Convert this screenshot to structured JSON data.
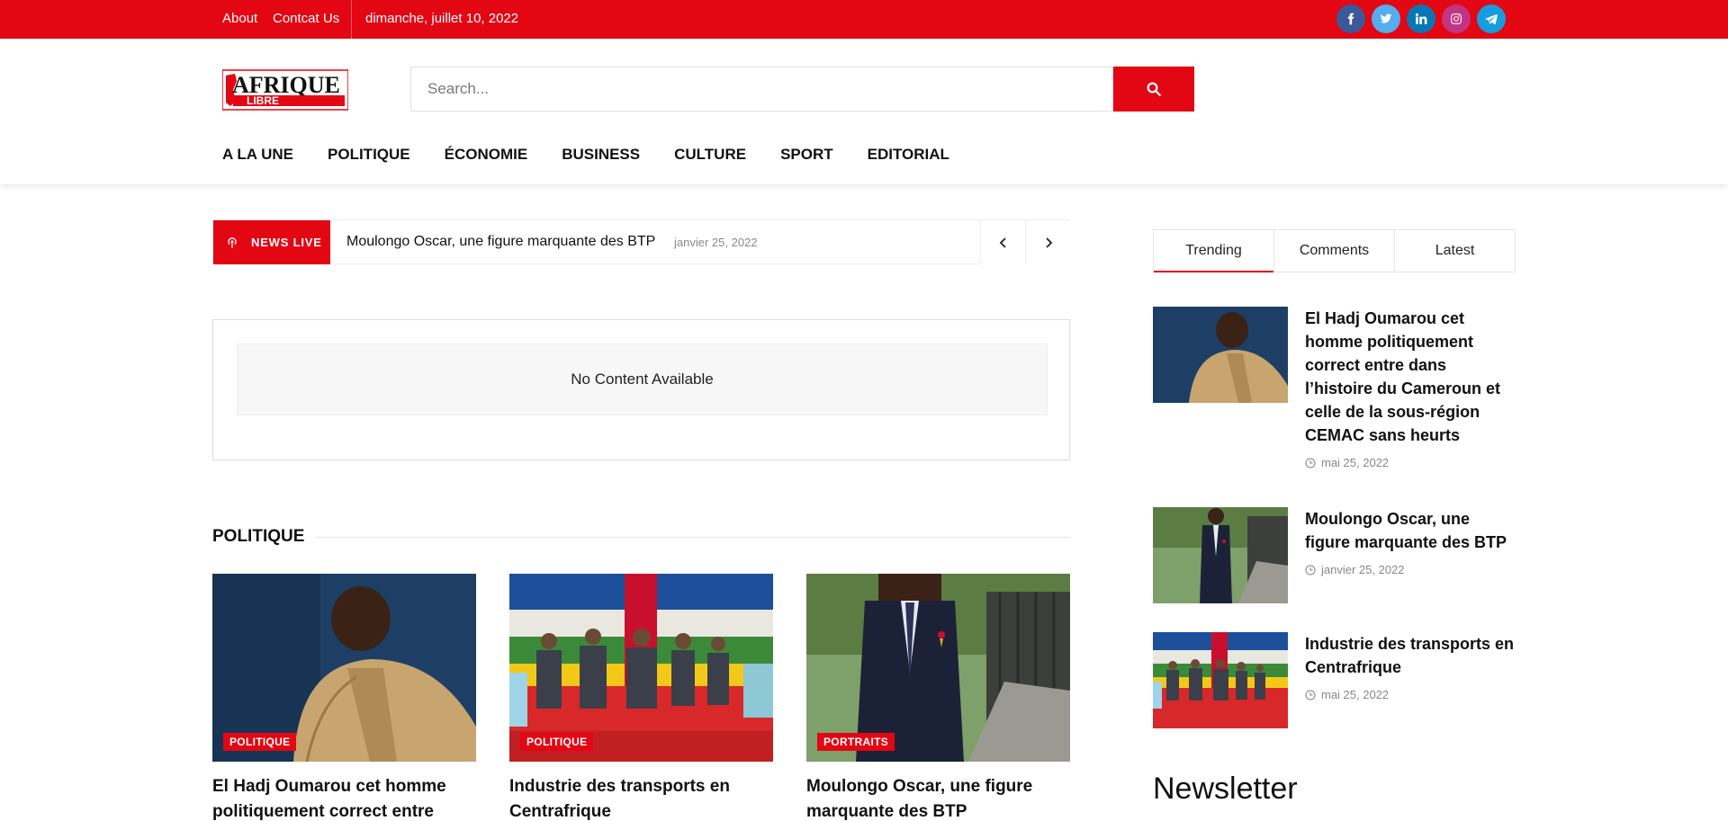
{
  "topbar": {
    "links": [
      "About",
      "Contcat Us"
    ],
    "date": "dimanche, juillet 10, 2022",
    "social": [
      {
        "name": "facebook-icon",
        "color": "#3b5998"
      },
      {
        "name": "twitter-icon",
        "color": "#55acee"
      },
      {
        "name": "linkedin-icon",
        "color": "#0976b4"
      },
      {
        "name": "instagram-icon",
        "color": "#c13584"
      },
      {
        "name": "telegram-icon",
        "color": "#179cde"
      }
    ]
  },
  "header": {
    "logo_text": "AFRIQUE LIBRE",
    "search_placeholder": "Search...",
    "nav": [
      "A LA UNE",
      "POLITIQUE",
      "ÉCONOMIE",
      "BUSINESS",
      "CULTURE",
      "SPORT",
      "EDITORIAL"
    ]
  },
  "ticker": {
    "badge": "NEWS LIVE",
    "title": "Moulongo Oscar, une figure marquante des BTP",
    "date": "janvier 25, 2022"
  },
  "content": {
    "empty_message": "No Content Available"
  },
  "section": {
    "title": "POLITIQUE",
    "cards": [
      {
        "category": "POLITIQUE",
        "title": "El Hadj Oumarou cet homme politiquement correct entre dans"
      },
      {
        "category": "POLITIQUE",
        "title": "Industrie des transports en Centrafrique"
      },
      {
        "category": "PORTRAITS",
        "title": "Moulongo Oscar, une figure marquante des BTP"
      }
    ]
  },
  "sidebar": {
    "tabs": [
      "Trending",
      "Comments",
      "Latest"
    ],
    "active_tab": "Trending",
    "items": [
      {
        "title": "El Hadj Oumarou cet homme politiquement correct entre dans l’histoire du Cameroun et celle de la sous-région CEMAC sans heurts",
        "date": "mai 25, 2022"
      },
      {
        "title": "Moulongo Oscar, une figure marquante des BTP",
        "date": "janvier 25, 2022"
      },
      {
        "title": "Industrie des transports en Centrafrique",
        "date": "mai 25, 2022"
      }
    ],
    "newsletter_title": "Newsletter"
  },
  "colors": {
    "brand_red": "#e30613"
  }
}
